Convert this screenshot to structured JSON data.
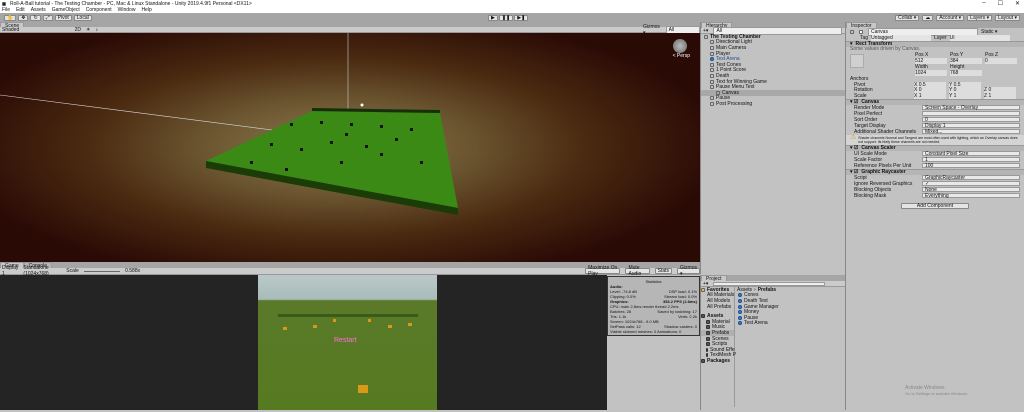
{
  "window": {
    "title": "Roll-A-Ball tutorial - The Testing Chamber - PC, Mac & Linux Standalone - Unity 2019.4.9f1 Personal <DX11>",
    "minimize": "–",
    "maximize": "☐",
    "close": "✕"
  },
  "menu": [
    "File",
    "Edit",
    "Assets",
    "GameObject",
    "Component",
    "Window",
    "Help"
  ],
  "toolbar": {
    "pivot": "Pivot",
    "local": "Local",
    "collab": "Collab ▾",
    "account": "Account ▾",
    "layers": "Layers ▾",
    "layout": "Layout ▾",
    "play": "▶",
    "pause": "❚❚",
    "step": "▶❚"
  },
  "scene": {
    "tabs": [
      "Scene"
    ],
    "shading": "Shaded",
    "mode2d": "2D",
    "gizmos": "Gizmos ▾",
    "search": "All",
    "persp": "< Persp"
  },
  "game": {
    "tabs": [
      "Game",
      "Console"
    ],
    "display": "Display 1",
    "resolution": "Standalone (1024x768)",
    "scale_label": "Scale",
    "scale_value": "0.588x",
    "maximize": "Maximize On Play",
    "mute": "Mute Audio",
    "stats": "Stats",
    "gizmos": "Gizmos ▾",
    "ui_button": "Restart"
  },
  "stats": {
    "title": "Statistics",
    "audio": "Audio:",
    "level": "Level: -74.8 dB",
    "clipping": "Clipping: 0.0%",
    "dsp": "DSP load: 0.1%",
    "stream": "Stream load: 0.0%",
    "graphics": "Graphics:",
    "fps": "353.2 FPS (2.8ms)",
    "cpu": "CPU: main 2.8ms  render thread 2.2ms",
    "batches": "Batches: 28",
    "saved": "Saved by batching: 17",
    "tris": "Tris: 1.1k",
    "verts": "Verts: 2.2k",
    "screen": "Screen: 1024x768 - 9.0 MB",
    "setpass": "SetPass calls: 12",
    "shadow": "Shadow casters: 0",
    "skinned": "Visible skinned meshes: 0  Animations: 0"
  },
  "hierarchy": {
    "title": "Hierarchy",
    "search": "All",
    "items": [
      {
        "label": "The Testing Chamber",
        "depth": 0,
        "bold": true
      },
      {
        "label": "Directional Light",
        "depth": 1
      },
      {
        "label": "Main Camera",
        "depth": 1
      },
      {
        "label": "Player",
        "depth": 1
      },
      {
        "label": "Test Arena",
        "depth": 1,
        "prefab": true
      },
      {
        "label": "Test Cones",
        "depth": 1
      },
      {
        "label": "1 Point Score",
        "depth": 1
      },
      {
        "label": "Death",
        "depth": 1
      },
      {
        "label": "Text for Winning Game",
        "depth": 1
      },
      {
        "label": "Pause Menu Text",
        "depth": 1
      },
      {
        "label": "Canvas",
        "depth": 2,
        "selected": true
      },
      {
        "label": "Pause",
        "depth": 1
      },
      {
        "label": "Post Processing",
        "depth": 1
      }
    ]
  },
  "project": {
    "title": "Project",
    "favorites": "Favorites",
    "fav_items": [
      "All Materials",
      "All Models",
      "All Prefabs"
    ],
    "assets": "Assets",
    "asset_folders": [
      "Material",
      "Music",
      "Prefabs",
      "Scenes",
      "Scripts",
      "Sound Effe",
      "TextMesh P"
    ],
    "packages": "Packages",
    "breadcrumb": [
      "Assets",
      "Prefabs"
    ],
    "files": [
      "Cones",
      "Death Test",
      "Game Manager",
      "Money",
      "Pause",
      "Test Arena"
    ]
  },
  "inspector": {
    "title": "Inspector",
    "object": "Canvas",
    "static": "Static ▾",
    "tag_label": "Tag",
    "tag": "Untagged",
    "layer_label": "Layer",
    "layer": "UI",
    "rect": {
      "title": "Rect Transform",
      "note": "Some values driven by Canvas.",
      "posx": "Pos X",
      "posy": "Pos Y",
      "posz": "Pos Z",
      "vx": "512",
      "vy": "384",
      "vz": "0",
      "width": "Width",
      "height": "Height",
      "w": "1024",
      "h": "768",
      "anchors": "Anchors",
      "pivot": "Pivot",
      "pivot_x": "X 0.5",
      "pivot_y": "Y 0.5",
      "rotation": "Rotation",
      "rot": [
        "X 0",
        "Y 0",
        "Z 0"
      ],
      "scale": "Scale",
      "sc": [
        "X 1",
        "Y 1",
        "Z 1"
      ]
    },
    "canvas": {
      "title": "Canvas",
      "fields": [
        [
          "Render Mode",
          "Screen Space - Overlay"
        ],
        [
          "Pixel Perfect",
          ""
        ],
        [
          "Sort Order",
          "0"
        ],
        [
          "Target Display",
          "Display 1"
        ],
        [
          "Additional Shader Channels",
          "Mixed..."
        ]
      ],
      "warning": "Shader channels Normal and Tangent are most often used with lighting, which an Overlay canvas does not support. Its likely these channels are not needed."
    },
    "scaler": {
      "title": "Canvas Scaler",
      "fields": [
        [
          "UI Scale Mode",
          "Constant Pixel Size"
        ],
        [
          "Scale Factor",
          "1"
        ],
        [
          "Reference Pixels Per Unit",
          "100"
        ]
      ]
    },
    "raycaster": {
      "title": "Graphic Raycaster",
      "fields": [
        [
          "Script",
          "GraphicRaycaster"
        ],
        [
          "Ignore Reversed Graphics",
          "✓"
        ],
        [
          "Blocking Objects",
          "None"
        ],
        [
          "Blocking Mask",
          "Everything"
        ]
      ]
    },
    "add_component": "Add Component"
  },
  "watermark": {
    "line1": "Activate Windows",
    "line2": "Go to Settings to activate Windows."
  }
}
